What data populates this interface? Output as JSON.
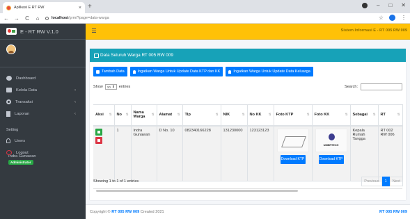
{
  "browser": {
    "tab_title": "Aplikasi E RT RW",
    "tab_close": "×",
    "new_tab": "+",
    "url_host": "localhost",
    "url_path": "/grm/?page=data-warga",
    "win_min": "–",
    "win_max": "□",
    "win_close": "✕",
    "star": "☆",
    "menu": "⋮"
  },
  "sidebar": {
    "brand": "E - RT RW V.1.0",
    "user_name": "Indra Gunawan",
    "user_role": "Administrator",
    "items": [
      {
        "label": "Dashboard",
        "icon": "dashboard-icon"
      },
      {
        "label": "Kelola Data",
        "icon": "folder-icon",
        "arrow": "‹"
      },
      {
        "label": "Transaksi",
        "icon": "cogs-icon",
        "arrow": "‹"
      },
      {
        "label": "Laporan",
        "icon": "file-icon",
        "arrow": "‹"
      }
    ],
    "section": "Setting",
    "setting_items": [
      {
        "label": "Users",
        "icon": "users-icon"
      },
      {
        "label": "Logout",
        "icon": "power-icon"
      }
    ]
  },
  "topnav": {
    "title": "Sistem Informasi E - RT 005 RW 009"
  },
  "card": {
    "title": "Data Seluruh Warga RT 005 RW 009",
    "buttons": {
      "tambah": "Tambah Data",
      "ingat_ktp": "Ingatkan Warga Untuk Update Data KTP dan KK",
      "ingat_kel": "Ingatkan Warga Untuk Update Data Keluarga"
    },
    "show_label": "Show",
    "show_value": "10",
    "entries_label": "entries",
    "search_label": "Search:",
    "columns": [
      "Aksi",
      "No",
      "Nama Warga",
      "Alamat",
      "Tlp",
      "NIK",
      "No KK",
      "Foto KTP",
      "Foto KK",
      "Sebagai",
      "RT"
    ],
    "row": {
      "no": "1",
      "nama": "Indra Gunawan",
      "alamat": "D No. 10",
      "tlp": "082340166228",
      "nik": "131230000",
      "no_kk": "123123123",
      "foto_kk_label": "UMBRTECH",
      "download_ktp": "Download KTP",
      "download_kk": "Download KTP",
      "sebagai": "Kepala Rumah Tangga",
      "rt": "RT 002 RW 006"
    },
    "info": "Showing 1 to 1 of 1 entries",
    "pager": {
      "prev": "Previous",
      "page": "1",
      "next": "Next"
    }
  },
  "footer": {
    "prefix": "Copyright ©",
    "link": "RT 005 RW 009",
    "suffix": "Created 2021",
    "right": "RT 005 RW 009"
  },
  "colors": {
    "topnav": "#ffc107",
    "sidebar": "#343a40",
    "card_head": "#17a2b8",
    "primary": "#007bff"
  }
}
